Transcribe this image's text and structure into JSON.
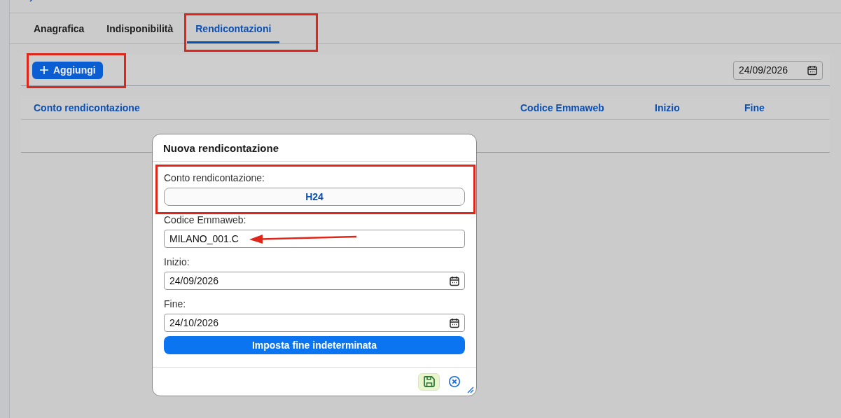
{
  "tabs": [
    {
      "label": "Anagrafica",
      "selected": false
    },
    {
      "label": "Indisponibilità",
      "selected": false
    },
    {
      "label": "Rendicontazioni",
      "selected": true
    }
  ],
  "toolbar": {
    "add_button": "Aggiungi",
    "date_field": {
      "value": "24/09/2026"
    }
  },
  "table": {
    "columns": [
      "Conto rendicontazione",
      "Codice Emmaweb",
      "Inizio",
      "Fine"
    ]
  },
  "dialog": {
    "title": "Nuova rendicontazione",
    "fields": [
      {
        "kind": "select",
        "label": "Conto rendicontazione:",
        "value": "H24"
      },
      {
        "kind": "text",
        "label": "Codice Emmaweb:",
        "value": "MILANO_001.C"
      },
      {
        "kind": "date",
        "label": "Inizio:",
        "value": "24/09/2026"
      },
      {
        "kind": "date",
        "label": "Fine:",
        "value": "24/10/2026"
      }
    ],
    "action_button": "Imposta fine indeterminata"
  }
}
